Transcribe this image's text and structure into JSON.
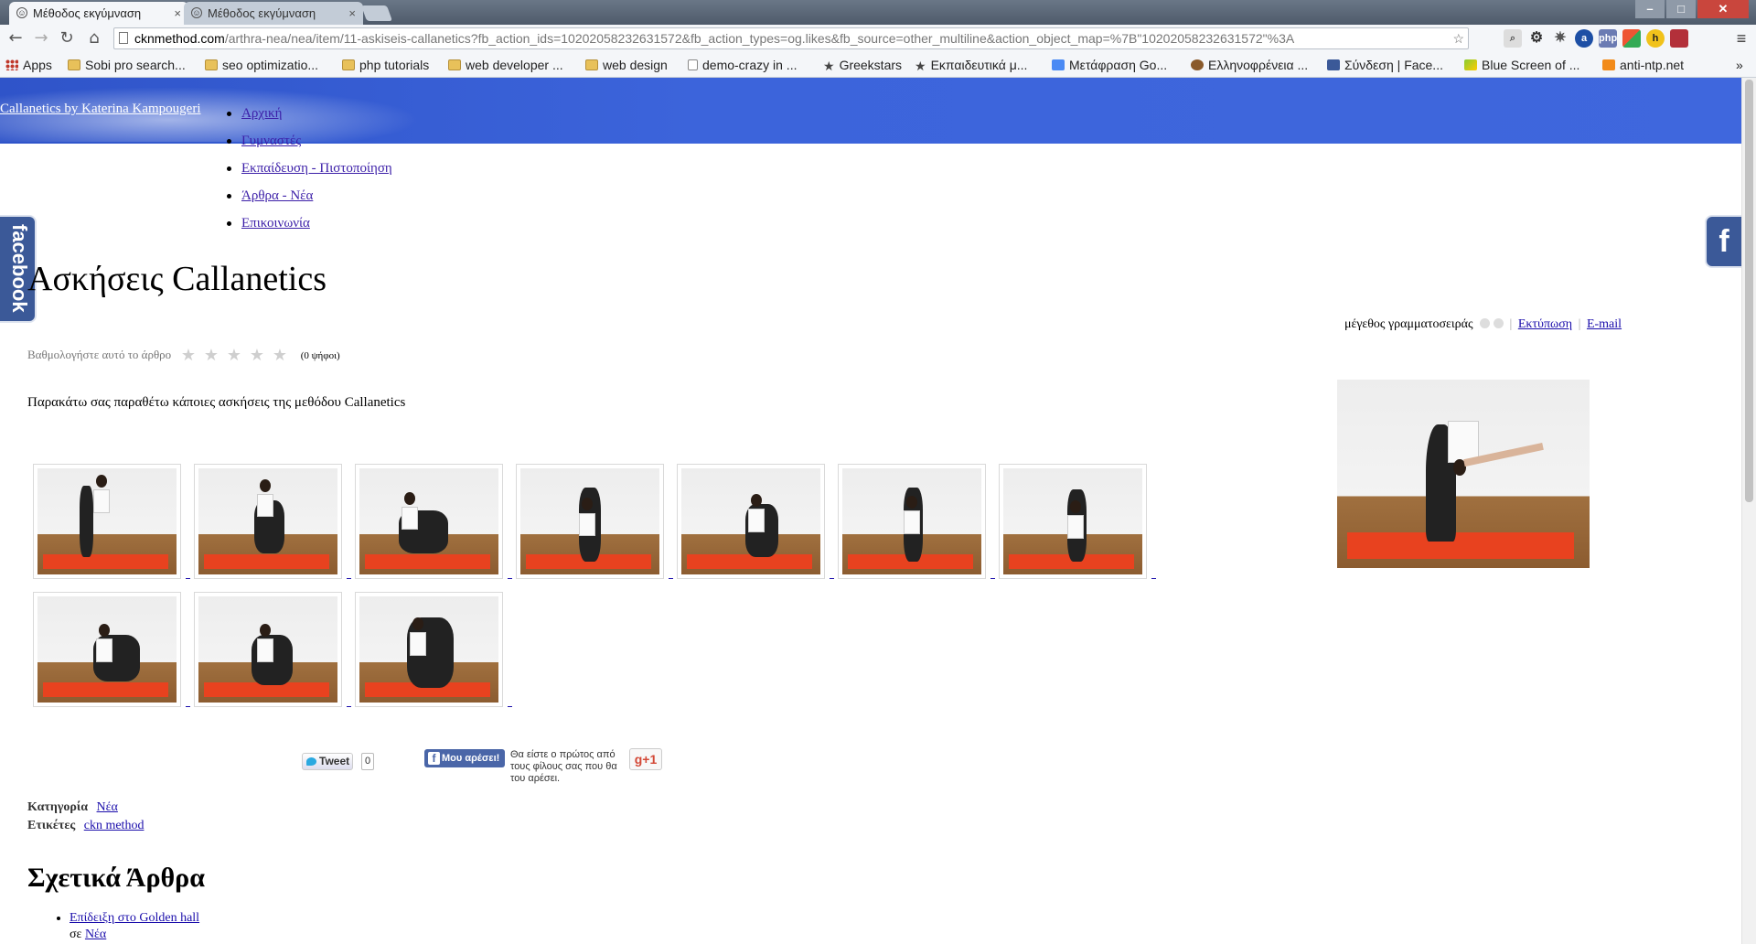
{
  "browser": {
    "tabs": [
      {
        "label": "Μέθοδος εκγύμναση"
      },
      {
        "label": "Μέθοδος εκγύμναση"
      }
    ],
    "url_host": "cknmethod.com",
    "url_path": "/arthra-nea/nea/item/11-askiseis-callanetics?fb_action_ids=10202058232631572&fb_action_types=og.likes&fb_source=other_multiline&action_object_map=%7B\"10202058232631572\"%3A",
    "bookmarks": [
      "Apps",
      "Sobi pro search...",
      "seo optimizatio...",
      "php tutorials",
      "web developer ...",
      "web design",
      "demo-crazy in ...",
      "Greekstars",
      "Εκπαιδευτικά μ...",
      "Μετάφραση Go...",
      "Ελληνοφρένεια ...",
      "Σύνδεση | Face...",
      "Blue Screen of ...",
      "anti-ntp.net"
    ],
    "more": "»"
  },
  "site": {
    "title": "Callanetics by Katerina Kampougeri",
    "nav": [
      "Αρχική",
      "Γυμναστές",
      "Εκπαίδευση - Πιστοποίηση",
      "Άρθρα - Νέα",
      "Επικοινωνία"
    ],
    "facebook_tab": "facebook",
    "facebook_f": "f"
  },
  "article": {
    "title": "Ασκήσεις Callanetics",
    "font_size_label": "μέγεθος γραμματοσειράς",
    "print_label": "Εκτύπωση",
    "email_label": "E-mail",
    "rating_label": "Βαθμολογήστε αυτό το άρθρο",
    "rating_stars": 5,
    "votes_label": "(0 ψήφοι)",
    "intro": "Παρακάτω σας παραθέτω κάποιες ασκήσεις της μεθόδου Callanetics",
    "gallery_count": 10
  },
  "social": {
    "tweet": "Tweet",
    "tweet_count": "0",
    "like": "Μου αρέσει!",
    "like_text": "Θα είστε ο πρώτος από τους φίλους σας που θα του αρέσει.",
    "gplus": "g+1"
  },
  "meta": {
    "category_label": "Κατηγορία",
    "category_value": "Νέα",
    "tags_label": "Ετικέτες",
    "tags_value": "ckn method"
  },
  "related": {
    "title": "Σχετικά Άρθρα",
    "items": [
      {
        "link": "Επίδειξη στο Golden hall",
        "prefix": "σε",
        "category": "Νέα"
      }
    ]
  }
}
